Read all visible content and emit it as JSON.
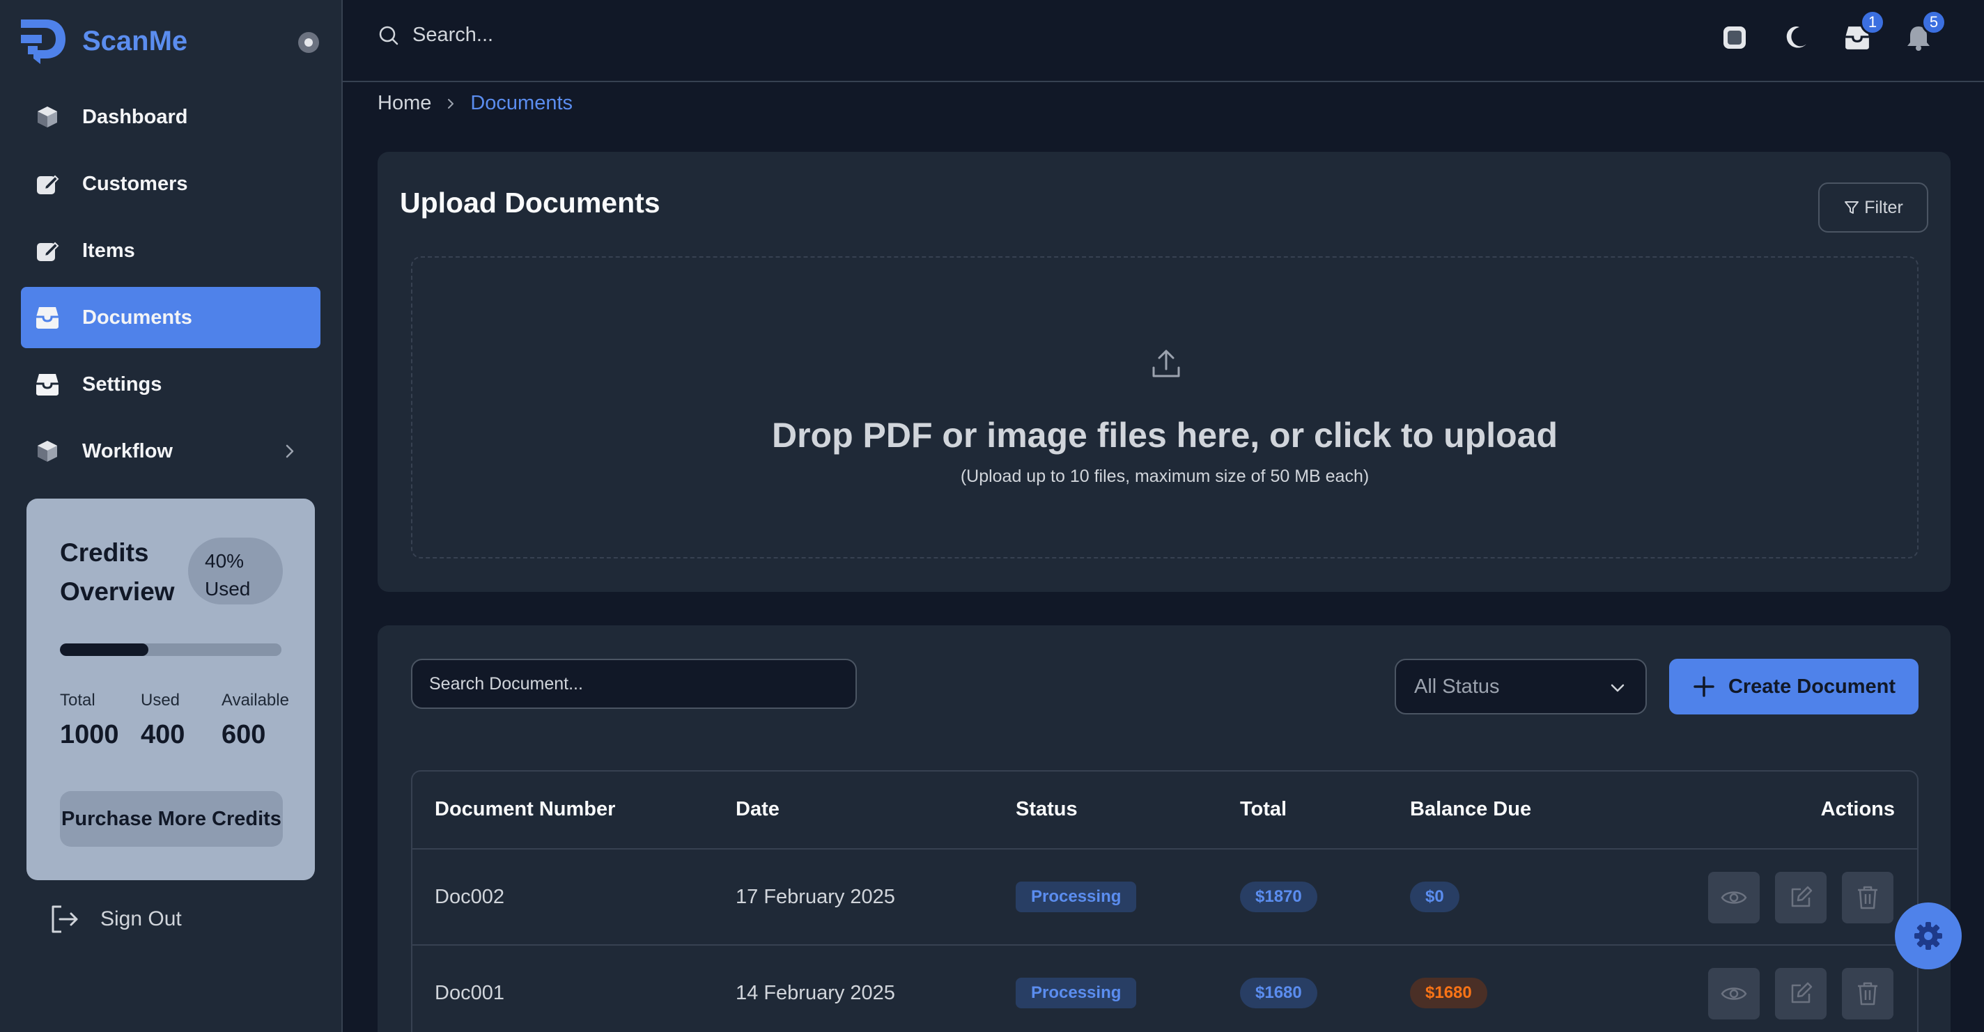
{
  "brand": {
    "name": "ScanMe"
  },
  "nav": {
    "items": [
      {
        "label": "Dashboard",
        "icon": "cube-icon"
      },
      {
        "label": "Customers",
        "icon": "edit-square-icon"
      },
      {
        "label": "Items",
        "icon": "edit-square-icon"
      },
      {
        "label": "Documents",
        "icon": "inbox-icon",
        "active": true
      },
      {
        "label": "Settings",
        "icon": "inbox-icon"
      },
      {
        "label": "Workflow",
        "icon": "cube-icon",
        "has_submenu": true
      }
    ]
  },
  "credits": {
    "title": "Credits Overview",
    "used_percent_label": "40%",
    "used_label": "Used",
    "progress": 0.4,
    "total_label": "Total",
    "total_value": "1000",
    "used_value_label": "Used",
    "used_value": "400",
    "available_label": "Available",
    "available_value": "600",
    "purchase_button": "Purchase More Credits"
  },
  "signout": {
    "label": "Sign Out"
  },
  "topbar": {
    "search_placeholder": "Search...",
    "inbox_badge": "1",
    "notifications_badge": "5"
  },
  "breadcrumb": {
    "home": "Home",
    "current": "Documents"
  },
  "upload": {
    "title": "Upload Documents",
    "filter_label": "Filter",
    "drop_text": "Drop PDF or image files here, or click to upload",
    "drop_subtext": "(Upload up to 10 files, maximum size of 50 MB each)"
  },
  "documents": {
    "search_placeholder": "Search Document...",
    "status_filter": "All Status",
    "create_button": "Create Document",
    "columns": {
      "number": "Document Number",
      "date": "Date",
      "status": "Status",
      "total": "Total",
      "balance": "Balance Due",
      "actions": "Actions"
    },
    "rows": [
      {
        "number": "Doc002",
        "date": "17 February 2025",
        "status": "Processing",
        "total": "$1870",
        "balance": "$0"
      },
      {
        "number": "Doc001",
        "date": "14 February 2025",
        "status": "Processing",
        "total": "$1680",
        "balance": "$1680"
      }
    ]
  },
  "colors": {
    "accent": "#4f82ea",
    "brand": "#5b8def",
    "background": "#111827",
    "panel": "#1f2937",
    "balance_due": "#f97316"
  }
}
